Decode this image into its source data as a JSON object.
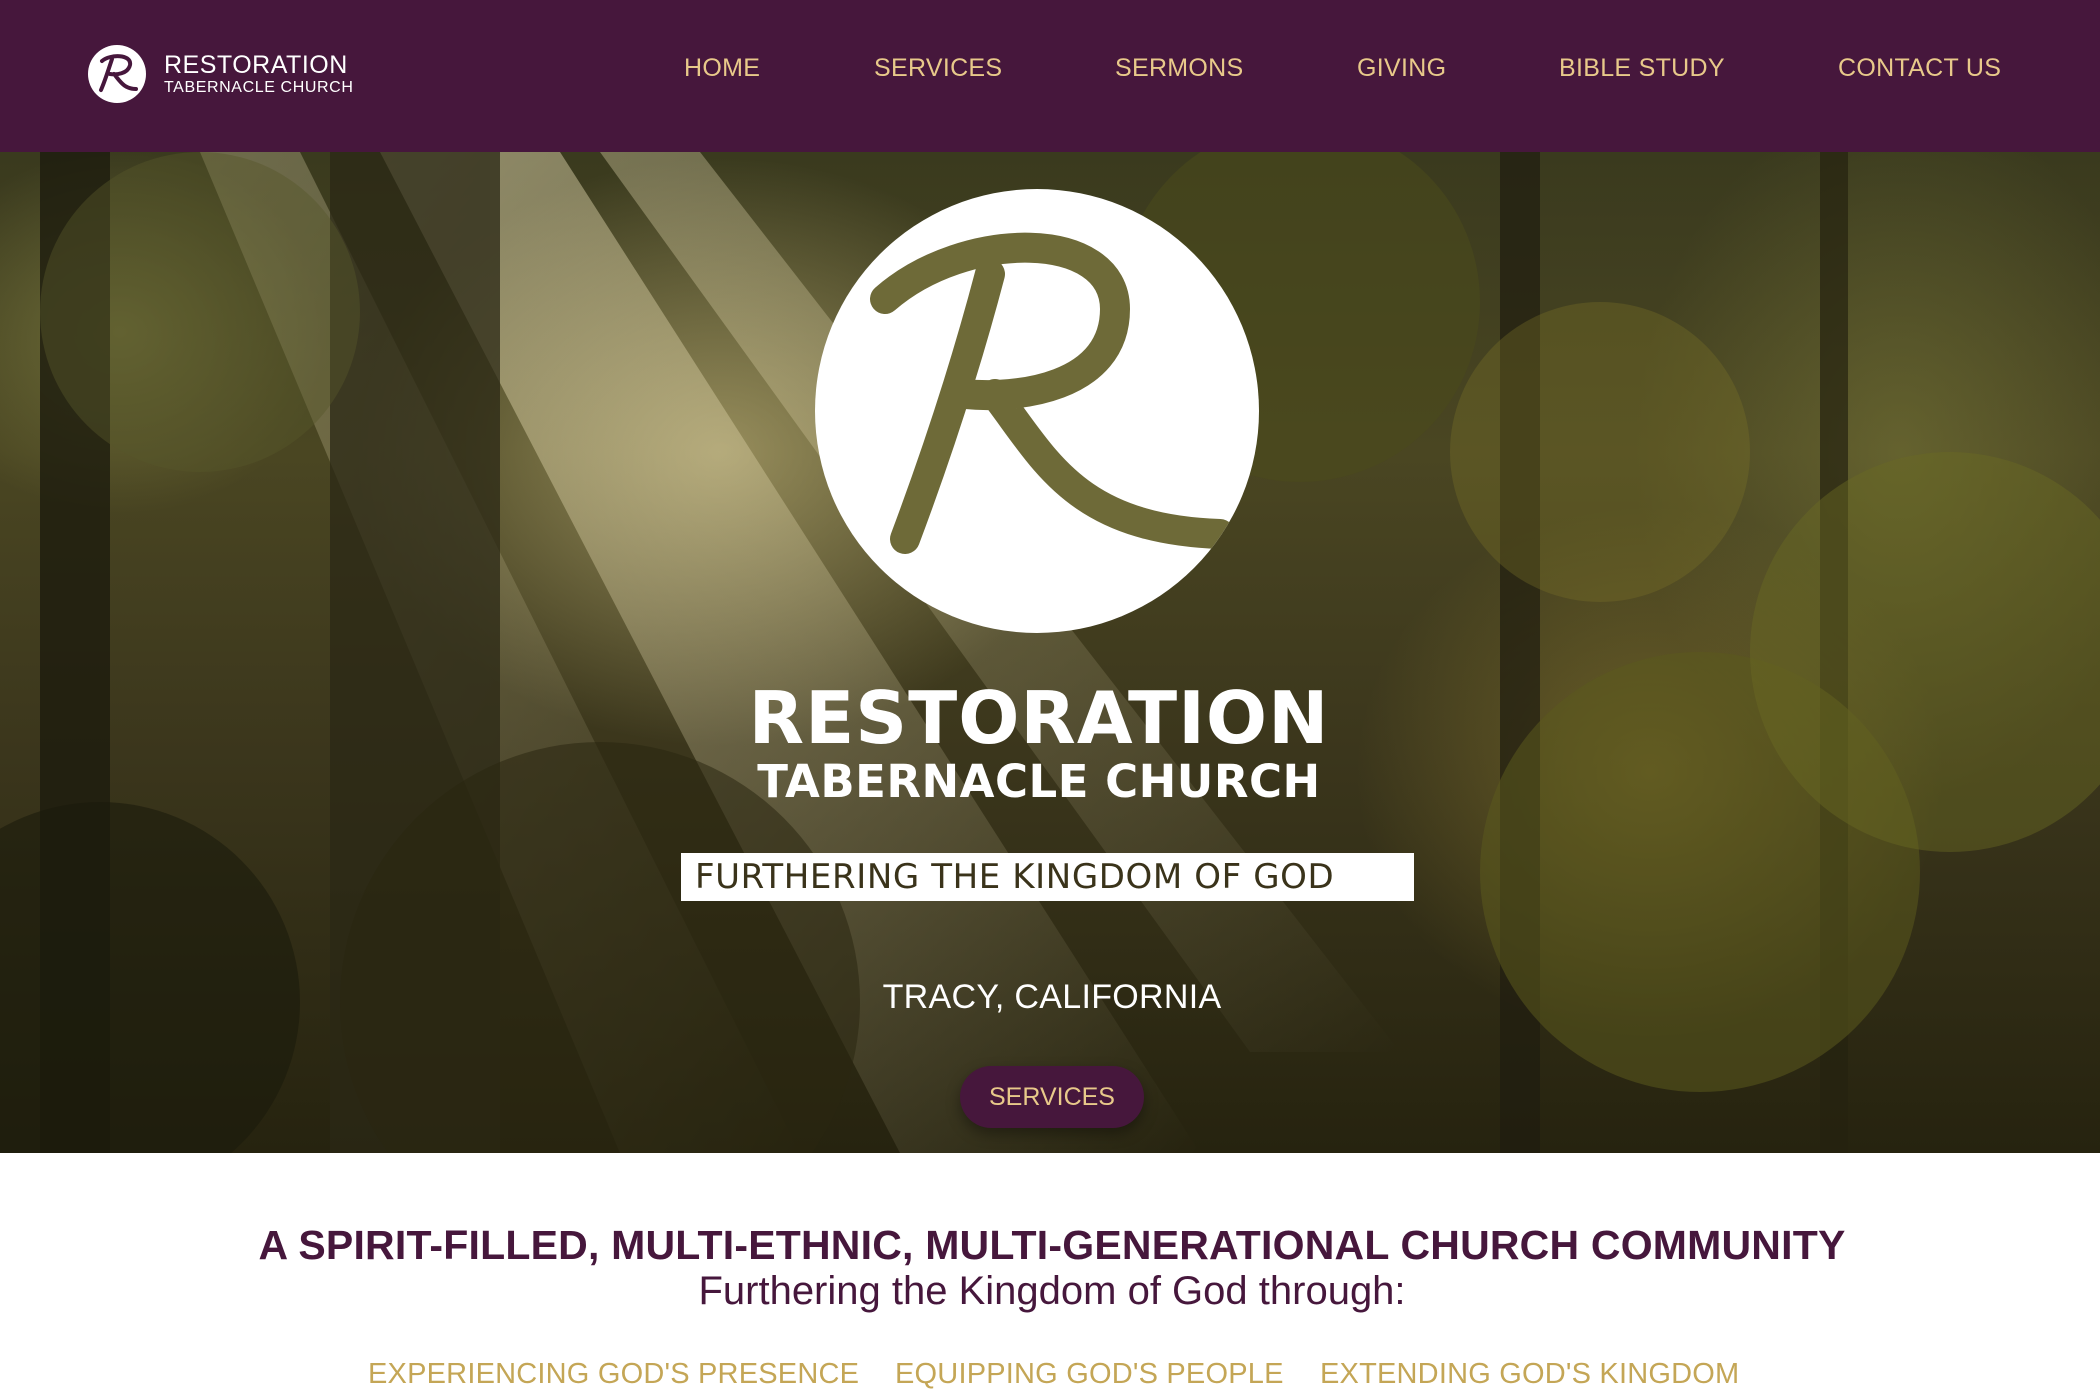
{
  "brand": {
    "line1": "RESTORATION",
    "line2": "TABERNACLE CHURCH",
    "logo_icon": "r-monogram-icon"
  },
  "nav": {
    "items": [
      {
        "label": "HOME"
      },
      {
        "label": "SERVICES"
      },
      {
        "label": "SERMONS"
      },
      {
        "label": "GIVING"
      },
      {
        "label": "BIBLE STUDY"
      },
      {
        "label": "CONTACT US"
      }
    ]
  },
  "hero": {
    "title": "RESTORATION",
    "subtitle": "TABERNACLE CHURCH",
    "tagline": "FURTHERING THE KINGDOM OF GOD",
    "location": "TRACY, CALIFORNIA",
    "button_label": "SERVICES",
    "background_image": "sunlit-forest-photo"
  },
  "mission": {
    "headline": "A SPIRIT-FILLED, MULTI-ETHNIC, MULTI-GENERATIONAL CHURCH COMMUNITY",
    "subheadline": "Furthering the Kingdom of God through:",
    "pillars": [
      "EXPERIENCING GOD'S PRESENCE",
      "EQUIPPING GOD'S PEOPLE",
      "EXTENDING GOD'S KINGDOM"
    ]
  },
  "colors": {
    "brand_purple": "#46173c",
    "nav_gold": "#e8c98a",
    "pillar_gold": "#c4a656",
    "white": "#ffffff"
  }
}
